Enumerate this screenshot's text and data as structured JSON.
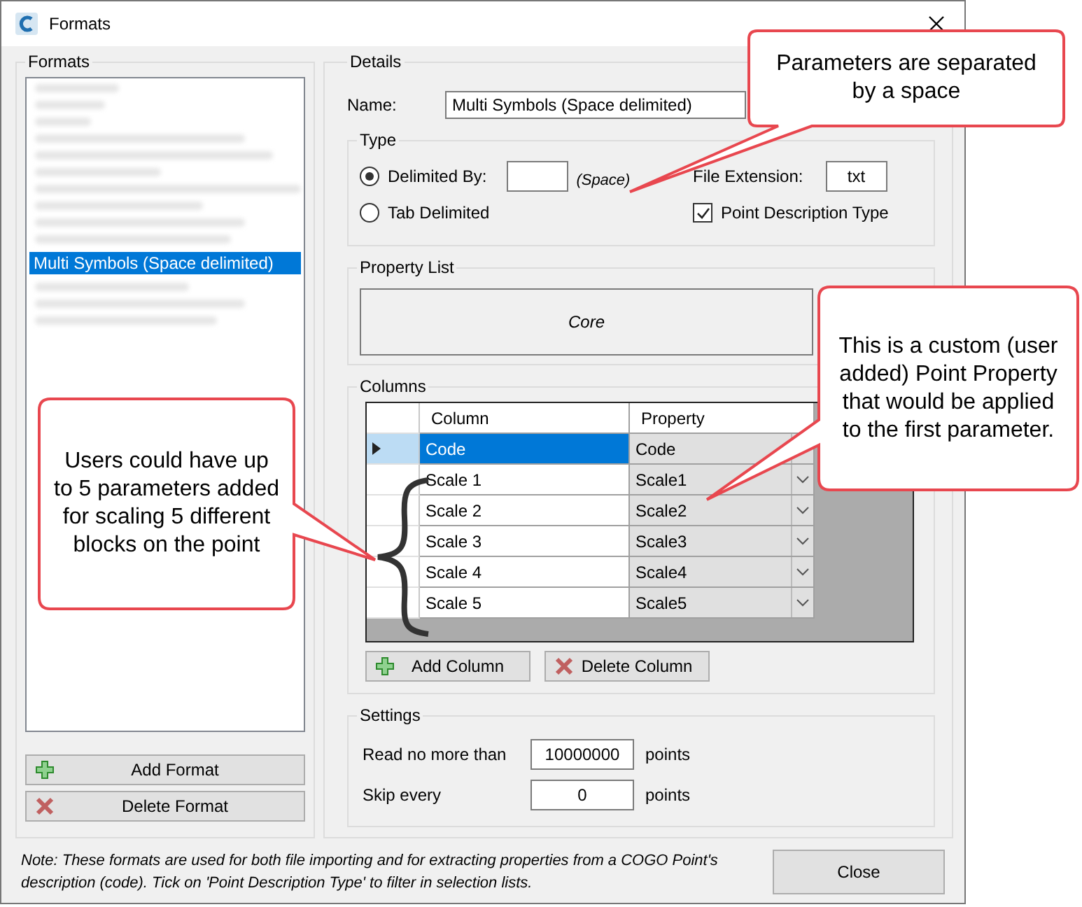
{
  "window": {
    "title": "Formats"
  },
  "formats_panel": {
    "title": "Formats",
    "items": [
      {
        "label": "Multi Symbols (Space delimited)",
        "selected": true
      }
    ],
    "buttons": [
      {
        "label": "Add Format",
        "kind": "add"
      },
      {
        "label": "Delete Format",
        "kind": "delete"
      }
    ]
  },
  "details": {
    "title": "Details",
    "name_label": "Name:",
    "name_value": "Multi Symbols (Space delimited)",
    "type": {
      "title": "Type",
      "options": [
        {
          "label": "Delimited By:",
          "selected": true
        },
        {
          "label": "Tab Delimited",
          "selected": false
        }
      ],
      "delimiter_hint": "(Space)",
      "file_extension_label": "File Extension:",
      "file_extension_value": "txt",
      "point_description": {
        "label": "Point Description Type",
        "checked": true
      }
    },
    "property_list": {
      "title": "Property List",
      "value": "Core"
    },
    "columns": {
      "title": "Columns",
      "headers": [
        "Column",
        "Property"
      ],
      "rows": [
        {
          "column": "Code",
          "property": "Code",
          "selected": true
        },
        {
          "column": "Scale 1",
          "property": "Scale1",
          "selected": false
        },
        {
          "column": "Scale 2",
          "property": "Scale2",
          "selected": false
        },
        {
          "column": "Scale 3",
          "property": "Scale3",
          "selected": false
        },
        {
          "column": "Scale 4",
          "property": "Scale4",
          "selected": false
        },
        {
          "column": "Scale 5",
          "property": "Scale5",
          "selected": false
        }
      ],
      "buttons": [
        {
          "label": "Add Column",
          "kind": "add"
        },
        {
          "label": "Delete Column",
          "kind": "delete"
        }
      ]
    },
    "settings": {
      "title": "Settings",
      "rows": [
        {
          "label": "Read no more than",
          "value": "10000000",
          "unit": "points"
        },
        {
          "label": "Skip every",
          "value": "0",
          "unit": "points"
        }
      ]
    }
  },
  "note": "Note: These formats are used for both file importing and for extracting properties from a COGO Point's description (code). Tick on 'Point Description Type' to filter in selection lists.",
  "close_button": "Close",
  "callouts": [
    {
      "text": "Parameters are separated by a space"
    },
    {
      "text": "This is a custom (user added) Point Property that would be applied to the first parameter."
    },
    {
      "text": "Users could have up to 5 parameters added for scaling 5 different blocks on the point"
    }
  ]
}
